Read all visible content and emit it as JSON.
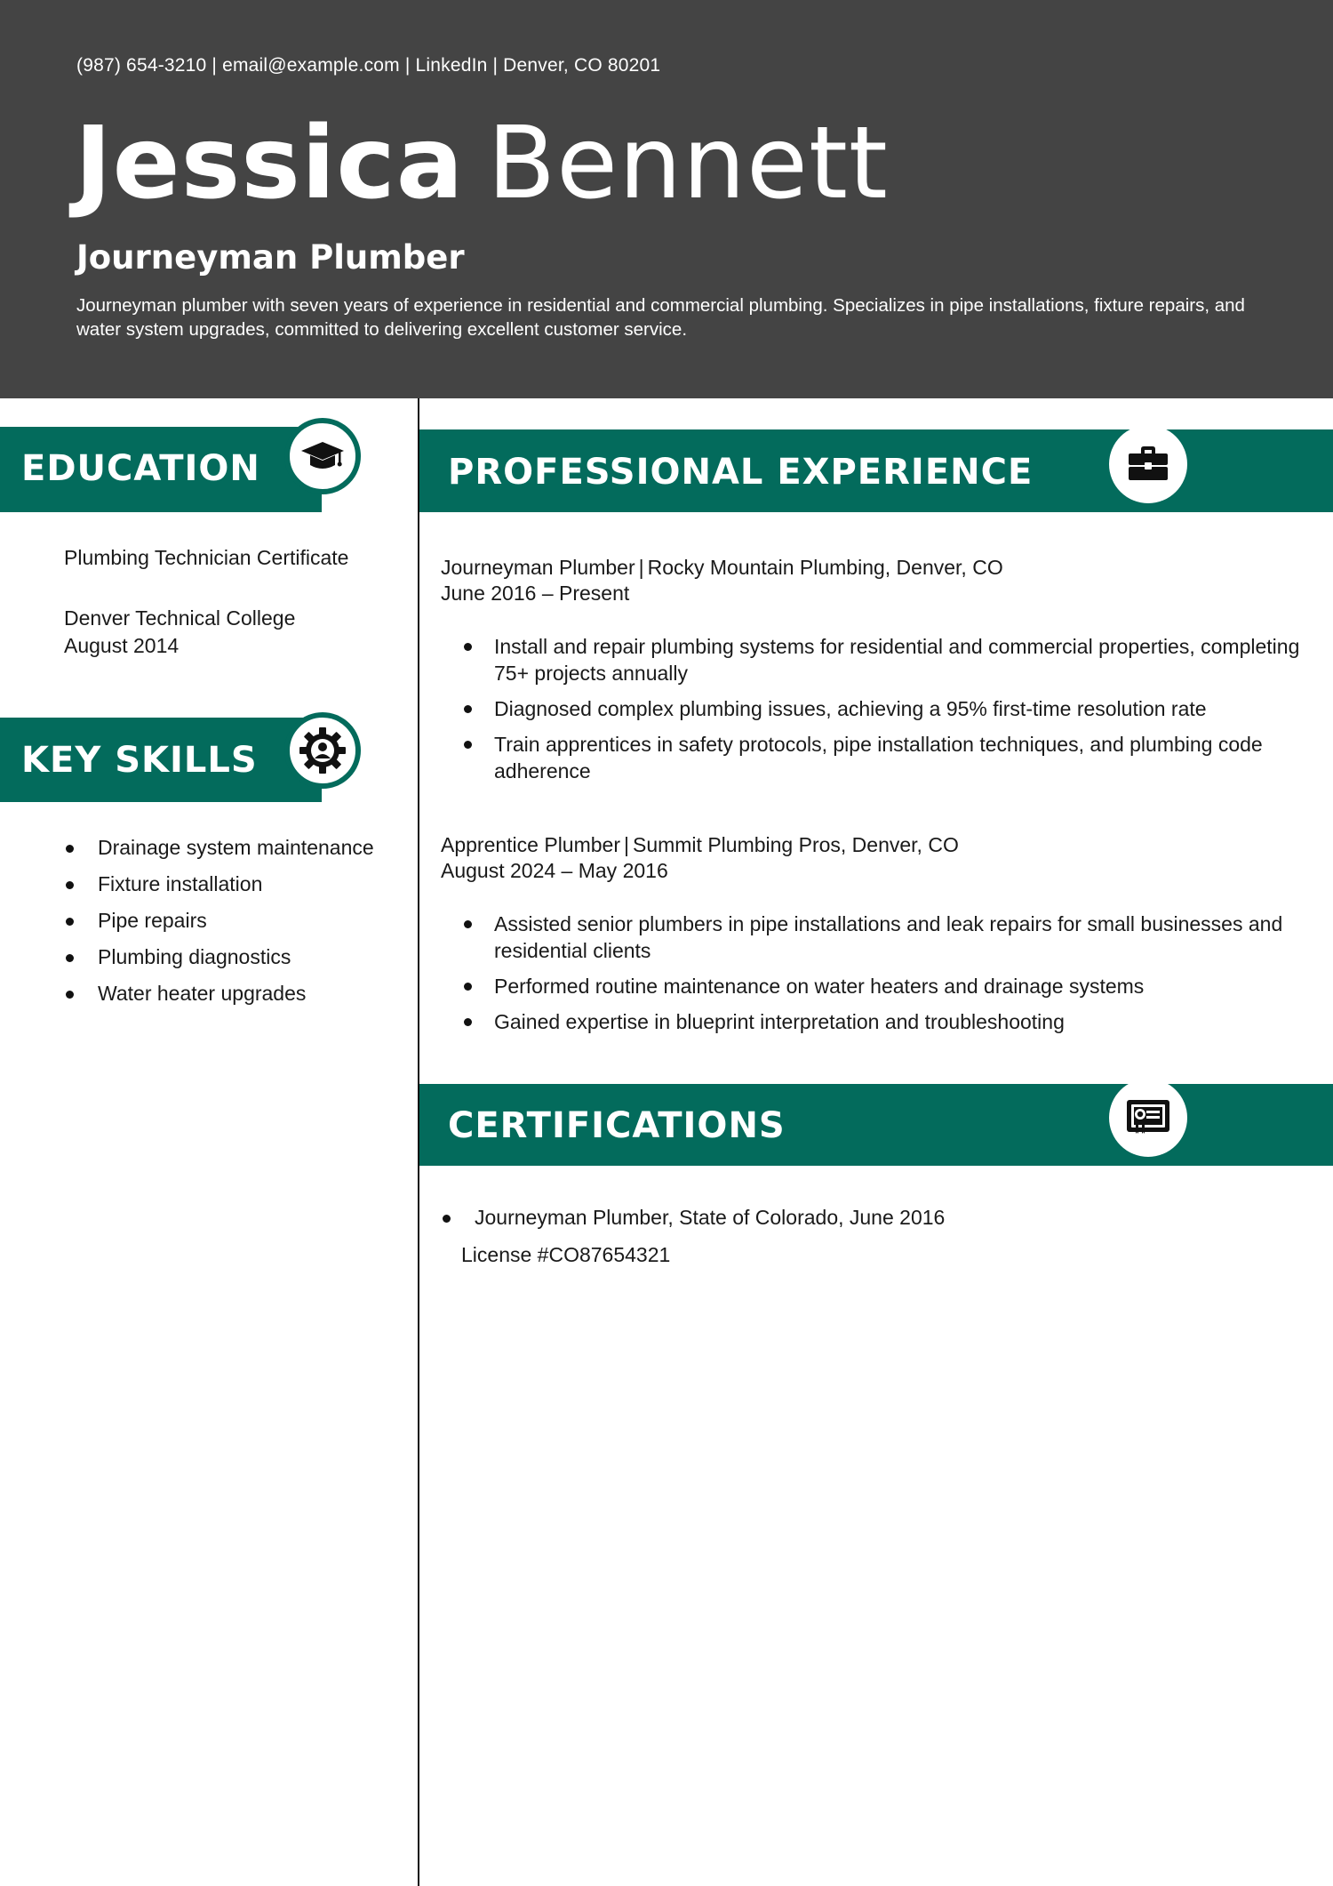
{
  "header": {
    "phone": "(987) 654-3210",
    "email": "email@example.com",
    "linkedin": "LinkedIn",
    "location": "Denver, CO 80201",
    "first_name": "Jessica",
    "last_name": "Bennett",
    "job_title": "Journeyman Plumber",
    "summary": "Journeyman plumber with seven years of experience in residential and commercial plumbing. Specializes in pipe installations, fixture repairs, and water system upgrades, committed to delivering excellent customer service."
  },
  "colors": {
    "header_bg": "#444444",
    "accent": "#036b5c"
  },
  "education": {
    "heading": "EDUCATION",
    "icon": "graduation-cap-icon",
    "certificate": "Plumbing Technician Certificate",
    "school": "Denver Technical College",
    "date": "August 2014"
  },
  "skills": {
    "heading": "KEY SKILLS",
    "icon": "gear-icon",
    "items": [
      "Drainage system maintenance",
      "Fixture installation",
      "Pipe repairs",
      "Plumbing diagnostics",
      "Water heater upgrades"
    ]
  },
  "experience": {
    "heading": "PROFESSIONAL EXPERIENCE",
    "icon": "toolbox-icon",
    "jobs": [
      {
        "title": "Journeyman Plumber",
        "company": "Rocky Mountain Plumbing, Denver, CO",
        "dates": "June 2016 – Present",
        "bullets": [
          "Install and repair plumbing systems for residential and commercial properties, completing 75+ projects annually",
          "Diagnosed complex plumbing issues, achieving a 95% first-time resolution rate",
          "Train apprentices in safety protocols, pipe installation techniques, and plumbing code adherence"
        ]
      },
      {
        "title": "Apprentice Plumber",
        "company": "Summit Plumbing Pros, Denver, CO",
        "dates": "August 2024 – May 2016",
        "bullets": [
          "Assisted senior plumbers in pipe installations and leak repairs for small businesses and residential clients",
          "Performed routine maintenance on water heaters and drainage systems",
          "Gained expertise in blueprint interpretation and troubleshooting"
        ]
      }
    ]
  },
  "certifications": {
    "heading": "CERTIFICATIONS",
    "icon": "certificate-icon",
    "item": "Journeyman Plumber, State of Colorado, June 2016",
    "license": "License #CO87654321"
  }
}
